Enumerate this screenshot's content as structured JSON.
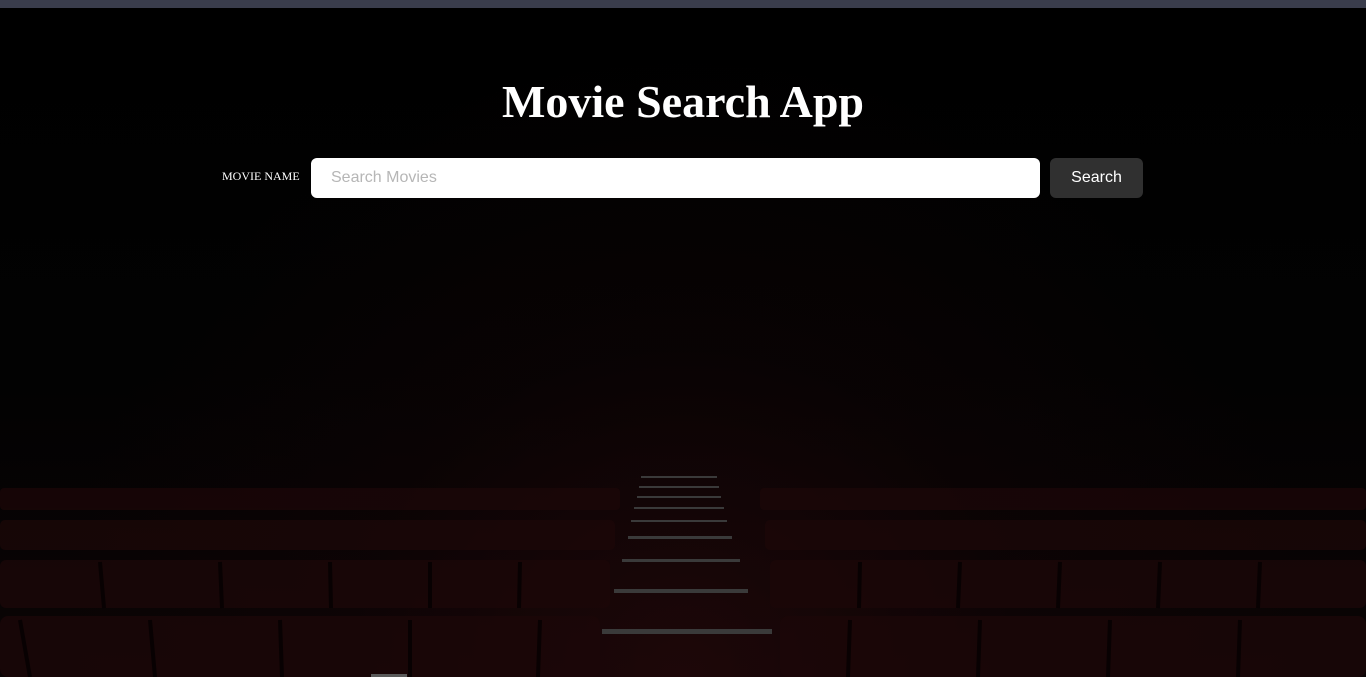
{
  "app": {
    "title": "Movie Search App"
  },
  "search": {
    "label": "MOVIE NAME",
    "placeholder": "Search Movies",
    "value": "",
    "button_label": "Search"
  },
  "theme": {
    "background": "#000000",
    "top_bar": "#3a3d4c",
    "button_bg": "#303030",
    "text": "#ffffff",
    "seat_color": "#2a0a0c"
  }
}
